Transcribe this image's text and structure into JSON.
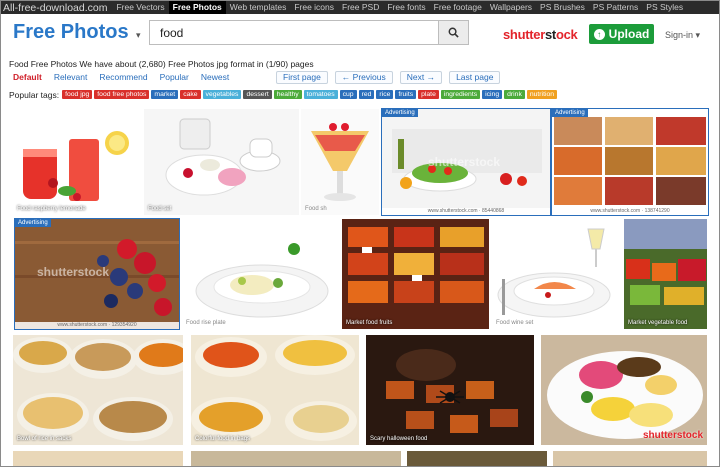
{
  "topnav": {
    "brand": "All-free-download.com",
    "links": [
      "Free Vectors",
      "Free Photos",
      "Web templates",
      "Free icons",
      "Free PSD",
      "Free fonts",
      "Free footage",
      "Wallpapers",
      "PS Brushes",
      "PS Patterns",
      "PS Styles"
    ],
    "active_index": 1
  },
  "header": {
    "logo": "Free Photos",
    "logo_caret": "▾",
    "search_value": "food",
    "shutterstock_red": "shutter",
    "shutterstock_black": "st",
    "shutterstock_red2": "ck",
    "upload_label": "Upload",
    "signin_label": "Sign-in ▾"
  },
  "result_info": "Food Free Photos We have about (2,680) Free Photos jpg format in (1/90) pages",
  "sort": [
    "Default",
    "Relevant",
    "Recommend",
    "Popular",
    "Newest"
  ],
  "pager": [
    "First page",
    "← Previous",
    "Next →",
    "Last page"
  ],
  "tags_label": "Popular tags:",
  "tags": [
    {
      "label": "food jpg",
      "color": "#d9302b"
    },
    {
      "label": "food free photos",
      "color": "#d9302b"
    },
    {
      "label": "market",
      "color": "#2a6ebb"
    },
    {
      "label": "cake",
      "color": "#d9302b"
    },
    {
      "label": "vegetables",
      "color": "#4ab0d9"
    },
    {
      "label": "dessert",
      "color": "#555555"
    },
    {
      "label": "healthy",
      "color": "#4caa3a"
    },
    {
      "label": "tomatoes",
      "color": "#4ab0d9"
    },
    {
      "label": "cup",
      "color": "#2a6ebb"
    },
    {
      "label": "red",
      "color": "#2a6ebb"
    },
    {
      "label": "rice",
      "color": "#2a6ebb"
    },
    {
      "label": "fruits",
      "color": "#2a6ebb"
    },
    {
      "label": "plate",
      "color": "#d9302b"
    },
    {
      "label": "ingredients",
      "color": "#4caa3a"
    },
    {
      "label": "icing",
      "color": "#2a6ebb"
    },
    {
      "label": "drink",
      "color": "#4caa3a"
    },
    {
      "label": "nutrition",
      "color": "#f0a020"
    }
  ],
  "photos": {
    "p1_caption": "Food raspberry lemonade",
    "p2_caption": "Food set",
    "p3_caption": "Food sh",
    "p4_badge": "Advertising",
    "p4_strip": "www.shutterstock.com · 85440868",
    "p5_badge": "Advertising",
    "p5_strip": "www.shutterstock.com · 138741290",
    "p6_badge": "Advertising",
    "p6_strip": "www.shutterstock.com · 129354920",
    "p7_caption": "Food rise plate",
    "p8_caption": "Market food fruits",
    "p9_caption": "Food wine set",
    "p10_caption": "Market vegetable food",
    "p11_caption": "Bowl of rice in sacks",
    "p12_caption": "Colorful food in bags",
    "p13_caption": "Scary halloween food",
    "watermark": "shutterstock",
    "corner_logo": "shutterstock"
  }
}
